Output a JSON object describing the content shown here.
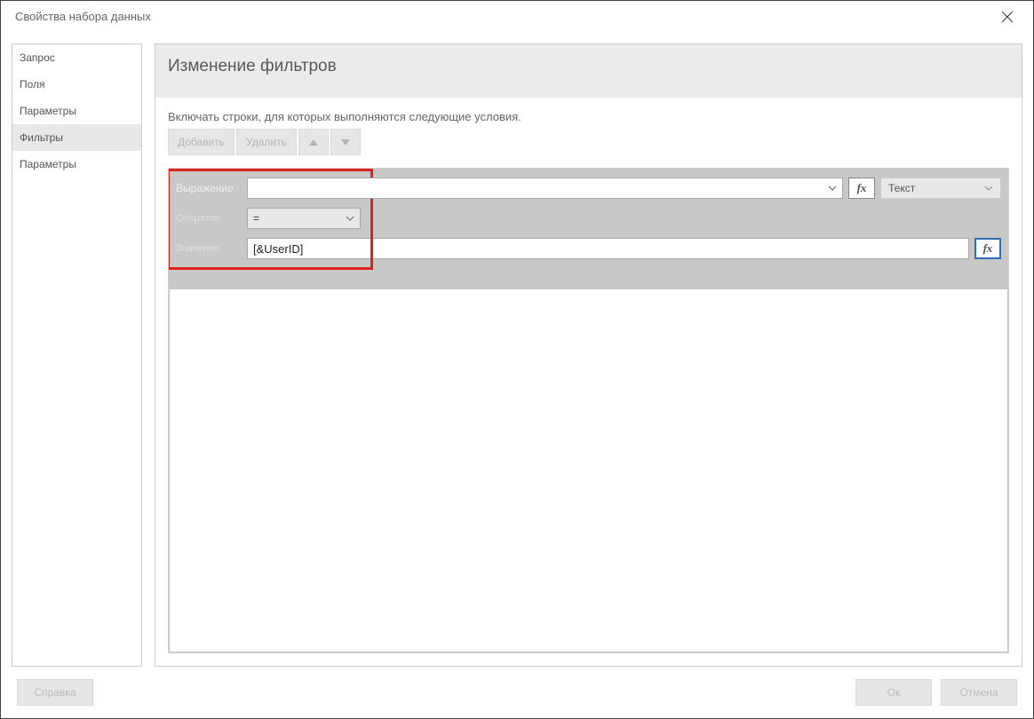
{
  "window": {
    "title": "Свойства набора данных"
  },
  "sidebar": {
    "items": [
      {
        "label": "Запрос"
      },
      {
        "label": "Поля"
      },
      {
        "label": "Параметры"
      },
      {
        "label": "Фильтры"
      },
      {
        "label": "Параметры"
      }
    ],
    "active_index": 3
  },
  "main": {
    "heading": "Изменение фильтров",
    "instruction": "Включать строки, для которых выполняются следующие условия.",
    "toolbar": {
      "add_label": "Добавить",
      "delete_label": "Удалить"
    },
    "filter": {
      "expression_label": "Выражение",
      "expression_value": "",
      "fx_label": "fx",
      "type_label": "Текст",
      "operator_label": "Оператор",
      "operator_value": "=",
      "value_label": "Значение",
      "value_value": "[&UserID]"
    }
  },
  "footer": {
    "help_label": "Справка",
    "ok_label": "Ок",
    "cancel_label": "Отмена"
  }
}
